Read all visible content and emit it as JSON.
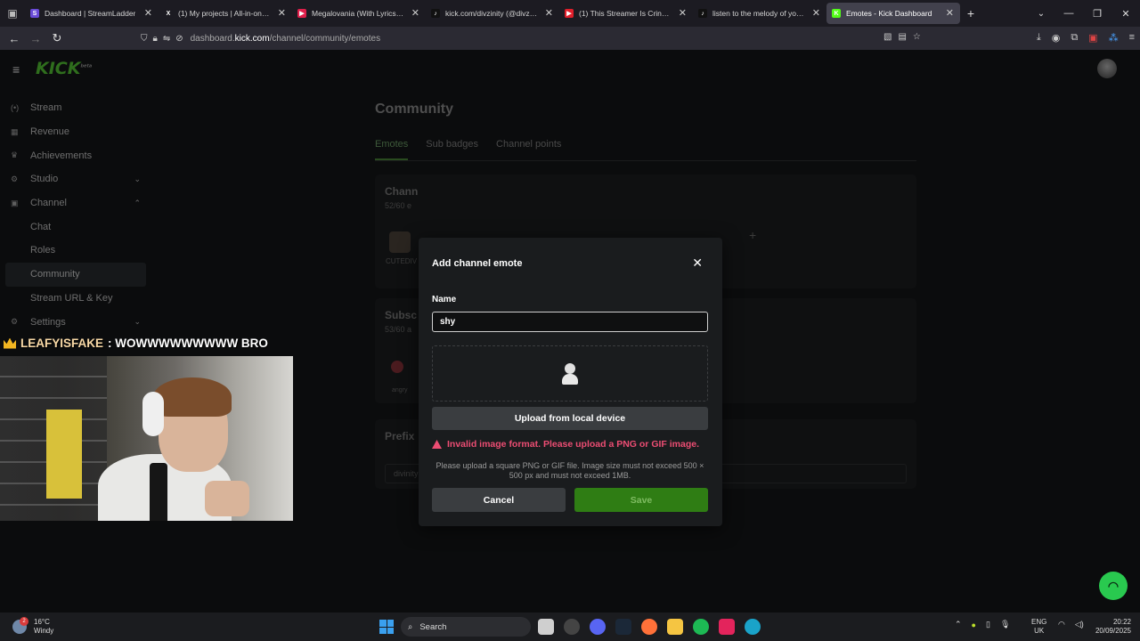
{
  "browser": {
    "tabs": [
      {
        "title": "Dashboard | StreamLadder",
        "color": "#6a4bd8",
        "glyph": "S"
      },
      {
        "title": "(1) My projects | All-in-one v",
        "color": "#1c1b22",
        "glyph": "X"
      },
      {
        "title": "Megalovania (With Lyrics) - The",
        "color": "#e01f4b",
        "glyph": "▶"
      },
      {
        "title": "kick.com/divzinity (@divzinityo",
        "color": "#111111",
        "glyph": "♪"
      },
      {
        "title": "(1) This Streamer Is Cringe... - Y",
        "color": "#e01f2b",
        "glyph": "▶"
      },
      {
        "title": "listen to the melody of your de",
        "color": "#111111",
        "glyph": "♪"
      },
      {
        "title": "Emotes - Kick Dashboard",
        "color": "#53fc18",
        "glyph": "K",
        "active": true
      }
    ],
    "url_prefix": "dashboard.",
    "url_domain": "kick.com",
    "url_path": "/channel/community/emotes"
  },
  "sidebar": {
    "logo": "KICK",
    "logo_badge": "beta",
    "items": [
      {
        "label": "Stream",
        "icon": "(•)"
      },
      {
        "label": "Revenue",
        "icon": "▦"
      },
      {
        "label": "Achievements",
        "icon": "♛"
      },
      {
        "label": "Studio",
        "icon": "⚙",
        "chevron": "⌄"
      },
      {
        "label": "Channel",
        "icon": "▣",
        "chevron": "⌃"
      },
      {
        "label": "Chat",
        "sub": true
      },
      {
        "label": "Roles",
        "sub": true
      },
      {
        "label": "Community",
        "sub": true,
        "active": true
      },
      {
        "label": "Stream URL & Key",
        "sub": true
      },
      {
        "label": "Settings",
        "icon": "⚙",
        "chevron": "⌄"
      }
    ]
  },
  "main": {
    "title": "Community",
    "tabs": [
      "Emotes",
      "Sub badges",
      "Channel points"
    ],
    "channel_card": {
      "title": "Chann",
      "sub": "52/60 e",
      "emote_name": "CUTEDIV"
    },
    "subs_card": {
      "title": "Subsc",
      "sub": "53/60 a",
      "emote_name": "angry"
    },
    "prefix_card": {
      "title": "Prefix",
      "value": "divinity"
    }
  },
  "overlay": {
    "chat_user": "LEAFYISFAKE",
    "chat_msg": ": WOWWWWWWWWW BRO"
  },
  "modal": {
    "title": "Add channel emote",
    "name_label": "Name",
    "name_value": "shy",
    "upload_label": "Upload from local device",
    "error": "Invalid image format. Please upload a PNG or GIF image.",
    "hint": "Please upload a square PNG or GIF file. Image size must not exceed 500 × 500 px and must not exceed 1MB.",
    "cancel_label": "Cancel",
    "save_label": "Save"
  },
  "colors": {
    "kick_green": "#53fc18",
    "error_pink": "#ec4d73",
    "save_green": "#2f7d14"
  },
  "taskbar": {
    "temp": "16°C",
    "weather": "Windy",
    "search": "Search",
    "lang_1": "ENG",
    "lang_2": "UK",
    "time": "20:22",
    "date": "20/09/2025"
  }
}
